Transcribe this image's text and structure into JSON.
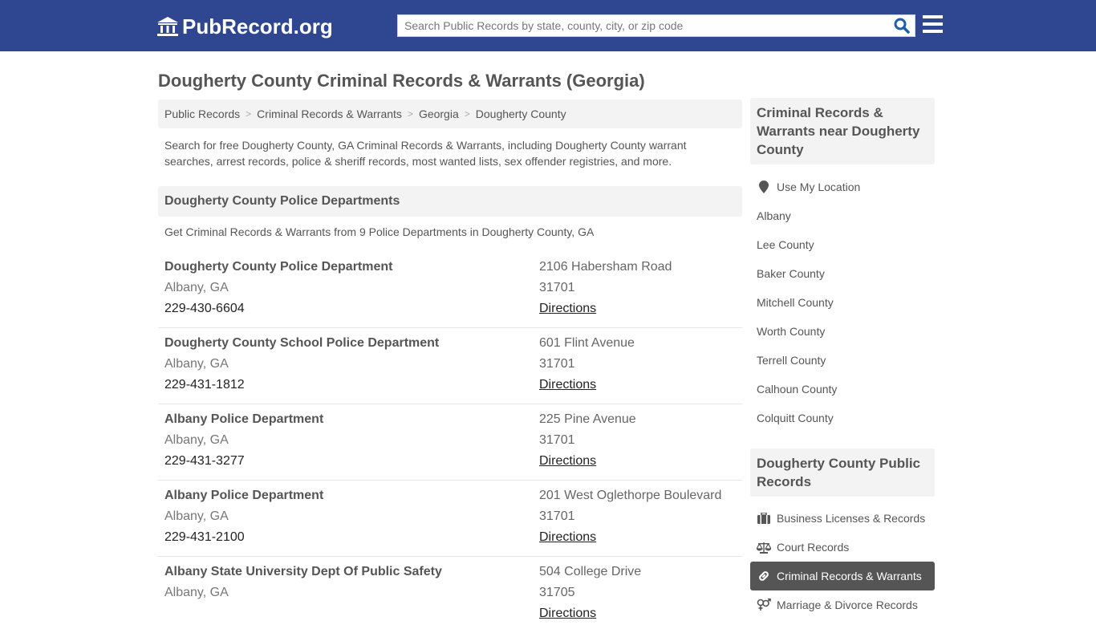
{
  "header": {
    "logo_text": "PubRecord.org",
    "logo_icon": "bank-building-icon",
    "search_placeholder": "Search Public Records by state, county, city, or zip code",
    "search_value": "",
    "search_icon": "search-icon",
    "menu_icon": "hamburger-menu-icon",
    "brand_color": "#2e4790"
  },
  "page": {
    "title": "Dougherty County Criminal Records & Warrants (Georgia)",
    "breadcrumb": [
      "Public Records",
      "Criminal Records & Warrants",
      "Georgia",
      "Dougherty County"
    ],
    "intro": "Search for free Dougherty County, GA Criminal Records & Warrants, including Dougherty County warrant searches, arrest records, police & sheriff records, most wanted lists, sex offender registries, and more."
  },
  "departments_section": {
    "heading": "Dougherty County Police Departments",
    "subtitle": "Get Criminal Records & Warrants from 9 Police Departments in Dougherty County, GA",
    "directions_label": "Directions",
    "items": [
      {
        "name": "Dougherty County Police Department",
        "city": "Albany, GA",
        "phone": "229-430-6604",
        "address": "2106 Habersham Road",
        "zip": "31701"
      },
      {
        "name": "Dougherty County School Police Department",
        "city": "Albany, GA",
        "phone": "229-431-1812",
        "address": "601 Flint Avenue",
        "zip": "31701"
      },
      {
        "name": "Albany Police Department",
        "city": "Albany, GA",
        "phone": "229-431-3277",
        "address": "225 Pine Avenue",
        "zip": "31701"
      },
      {
        "name": "Albany Police Department",
        "city": "Albany, GA",
        "phone": "229-431-2100",
        "address": "201 West Oglethorpe Boulevard",
        "zip": "31701"
      },
      {
        "name": "Albany State University Dept Of Public Safety",
        "city": "Albany, GA",
        "phone": "",
        "address": "504 College Drive",
        "zip": "31705"
      }
    ]
  },
  "sidebar": {
    "nearby": {
      "heading": "Criminal Records & Warrants near Dougherty County",
      "use_location": "Use My Location",
      "items": [
        "Albany",
        "Lee County",
        "Baker County",
        "Mitchell County",
        "Worth County",
        "Terrell County",
        "Calhoun County",
        "Colquitt County"
      ]
    },
    "public_records": {
      "heading": "Dougherty County Public Records",
      "items": [
        {
          "label": "Business Licenses & Records",
          "icon": "briefcase-icon",
          "active": false
        },
        {
          "label": "Court Records",
          "icon": "scales-icon",
          "active": false
        },
        {
          "label": "Criminal Records & Warrants",
          "icon": "link-icon",
          "active": true
        },
        {
          "label": "Marriage & Divorce Records",
          "icon": "gender-symbols-icon",
          "active": false
        }
      ]
    }
  }
}
